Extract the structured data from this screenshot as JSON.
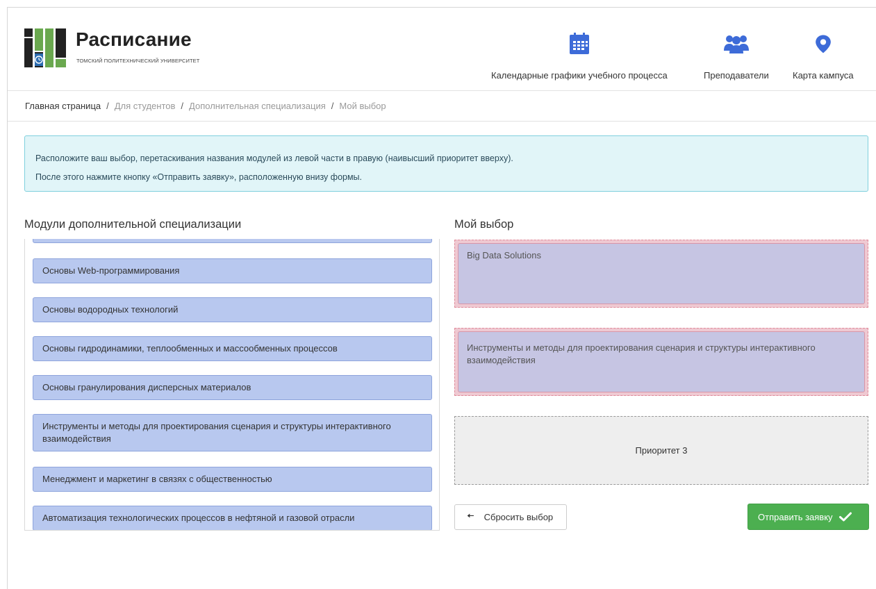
{
  "header": {
    "logo_title": "Расписание",
    "logo_subtitle": "ТОМСКИЙ ПОЛИТЕХНИЧЕСКИЙ УНИВЕРСИТЕТ",
    "nav": [
      {
        "label": "Календарные графики учебного процесса",
        "icon": "calendar-icon"
      },
      {
        "label": "Преподаватели",
        "icon": "people-icon"
      },
      {
        "label": "Карта кампуса",
        "icon": "map-pin-icon"
      }
    ]
  },
  "breadcrumb": [
    "Главная страница",
    "Для студентов",
    "Дополнительная специализация",
    "Мой выбор"
  ],
  "alert": {
    "line1": "Расположите ваш выбор, перетаскивания названия модулей из левой части в правую (наивысший приоритет вверху).",
    "line2": "После этого нажмите кнопку «Отправить заявку», расположенную внизу формы."
  },
  "modules": {
    "title": "Модули дополнительной специализации",
    "items": [
      "Основы Web-программирования",
      "Основы водородных технологий",
      "Основы гидродинамики, теплообменных и массообменных процессов",
      "Основы гранулирования дисперсных материалов",
      "Инструменты и методы для проектирования сценария и структуры интерактивного взаимодействия",
      "Менеджмент и маркетинг в связях с общественностью",
      "Автоматизация технологических процессов в нефтяной и газовой отрасли"
    ]
  },
  "choice": {
    "title": "Мой выбор",
    "slots": [
      "Big Data Solutions",
      "Инструменты и методы для проектирования сценария и структуры интерактивного взаимодействия",
      "Приоритет 3"
    ]
  },
  "buttons": {
    "reset": "Сбросить выбор",
    "submit": "Отправить заявку"
  },
  "colors": {
    "module_bg": "#b8c8ef",
    "chosen_bg": "#c6c5e3",
    "alert_bg": "#e1f5f8",
    "submit_bg": "#4caf50",
    "accent": "#3d6bd8"
  }
}
